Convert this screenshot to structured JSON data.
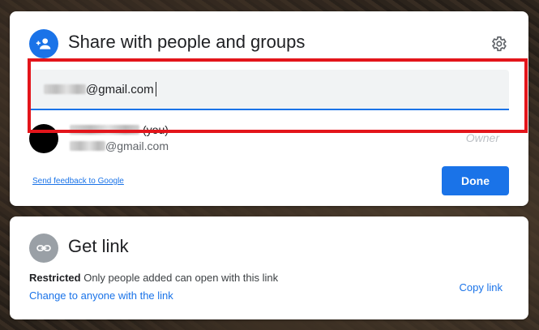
{
  "share_dialog": {
    "title": "Share with people and groups",
    "input_value_suffix": "@gmail.com",
    "person": {
      "name_suffix": "(you)",
      "email_suffix": "@gmail.com",
      "role": "Owner"
    },
    "feedback_link": "Send feedback to Google",
    "done_label": "Done"
  },
  "link_dialog": {
    "title": "Get link",
    "restricted_label": "Restricted",
    "restricted_desc": "Only people added can open with this link",
    "change_link": "Change to anyone with the link",
    "copy_link": "Copy link"
  },
  "colors": {
    "accent": "#1a73e8",
    "highlight": "#e3151b",
    "icon_grey": "#9aa0a6"
  },
  "icons": [
    "add-person-icon",
    "gear-icon",
    "link-icon"
  ]
}
